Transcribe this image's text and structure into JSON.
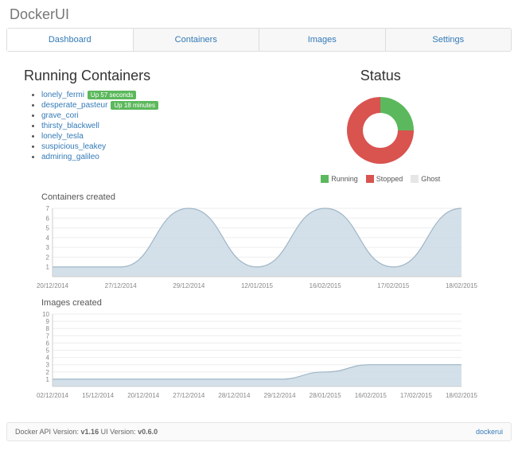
{
  "app_title": "DockerUI",
  "tabs": [
    "Dashboard",
    "Containers",
    "Images",
    "Settings"
  ],
  "active_tab": 0,
  "running": {
    "heading": "Running Containers",
    "items": [
      {
        "name": "lonely_fermi",
        "status": "Up 57 seconds"
      },
      {
        "name": "desperate_pasteur",
        "status": "Up 18 minutes"
      },
      {
        "name": "grave_cori",
        "status": null
      },
      {
        "name": "thirsty_blackwell",
        "status": null
      },
      {
        "name": "lonely_tesla",
        "status": null
      },
      {
        "name": "suspicious_leakey",
        "status": null
      },
      {
        "name": "admiring_galileo",
        "status": null
      }
    ]
  },
  "status": {
    "heading": "Status",
    "legend": [
      {
        "label": "Running",
        "color": "#5cb85c"
      },
      {
        "label": "Stopped",
        "color": "#d9534f"
      },
      {
        "label": "Ghost",
        "color": "#e6e6e6"
      }
    ]
  },
  "chart_data": [
    {
      "type": "pie",
      "title": "Status",
      "series": [
        {
          "name": "Running",
          "value": 25,
          "color": "#5cb85c"
        },
        {
          "name": "Stopped",
          "value": 75,
          "color": "#d9534f"
        },
        {
          "name": "Ghost",
          "value": 0,
          "color": "#e6e6e6"
        }
      ]
    },
    {
      "type": "area",
      "title": "Containers created",
      "categories": [
        "20/12/2014",
        "27/12/2014",
        "29/12/2014",
        "12/01/2015",
        "16/02/2015",
        "17/02/2015",
        "18/02/2015"
      ],
      "values": [
        1,
        1,
        7,
        1,
        7,
        1,
        7
      ],
      "ylim": [
        0,
        7
      ],
      "yticks": [
        1,
        2,
        3,
        4,
        5,
        6,
        7
      ]
    },
    {
      "type": "area",
      "title": "Images created",
      "categories": [
        "02/12/2014",
        "15/12/2014",
        "20/12/2014",
        "27/12/2014",
        "28/12/2014",
        "29/12/2014",
        "28/01/2015",
        "16/02/2015",
        "17/02/2015",
        "18/02/2015"
      ],
      "values": [
        1,
        1,
        1,
        1,
        1,
        1,
        2,
        3,
        3,
        3
      ],
      "ylim": [
        0,
        10
      ],
      "yticks": [
        1,
        2,
        3,
        4,
        5,
        6,
        7,
        8,
        9,
        10
      ]
    }
  ],
  "footer": {
    "api_label": "Docker API Version: ",
    "api_version": "v1.16",
    "ui_label": " UI Version: ",
    "ui_version": "v0.6.0",
    "link": "dockerui"
  }
}
